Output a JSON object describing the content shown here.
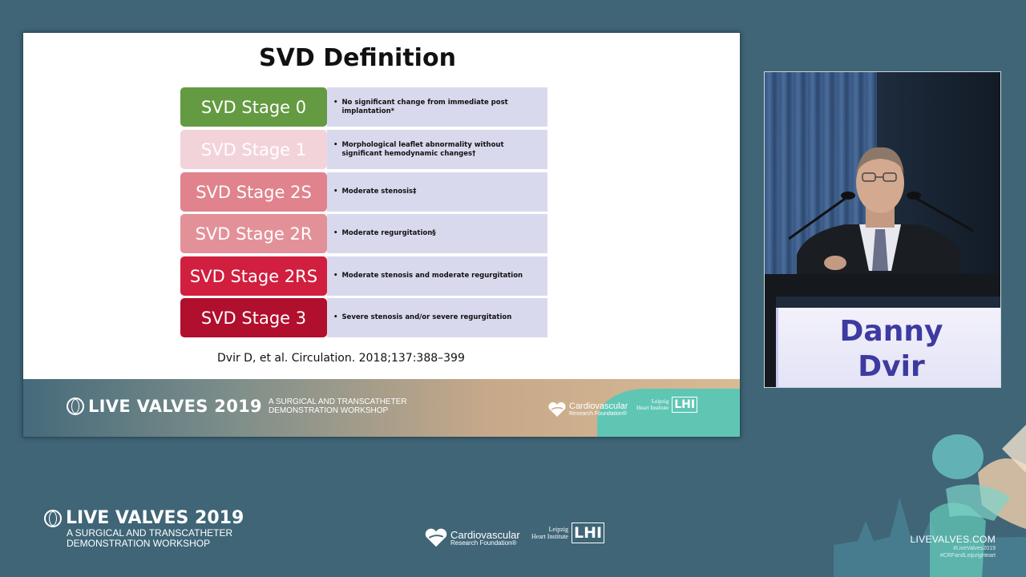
{
  "slide": {
    "title": "SVD Definition",
    "stages": [
      {
        "label": "SVD Stage 0",
        "description": "No significant change from immediate post implantation*",
        "color": "#649a41"
      },
      {
        "label": "SVD Stage 1",
        "description": "Morphological leaflet abnormality without significant hemodynamic changes†",
        "color": "#f3d3da"
      },
      {
        "label": "SVD Stage 2S",
        "description": "Moderate stenosis‡",
        "color": "#e0838d"
      },
      {
        "label": "SVD Stage 2R",
        "description": "Moderate regurgitation§",
        "color": "#e39199"
      },
      {
        "label": "SVD Stage 2RS",
        "description": "Moderate stenosis and moderate regurgitation",
        "color": "#d11f3f"
      },
      {
        "label": "SVD Stage 3",
        "description": "Severe stenosis and/or severe regurgitation",
        "color": "#b10f2e"
      }
    ],
    "bullet": "•",
    "citation": "Dvir D, et al. Circulation. 2018;137:388–399",
    "footer": {
      "event_name": "LIVE VALVES 2019",
      "event_sub_1": "A SURGICAL AND TRANSCATHETER",
      "event_sub_2": "DEMONSTRATION WORKSHOP",
      "crf_line1": "Cardiovascular",
      "crf_line2": "Research Foundation®",
      "lhi_line1": "Leipzig",
      "lhi_line2": "Heart Institute",
      "lhi_mark": "LHI"
    }
  },
  "speaker": {
    "first_name": "Danny",
    "last_name": "Dvir"
  },
  "bottom": {
    "event_name": "LIVE VALVES 2019",
    "event_sub_1": "A SURGICAL AND TRANSCATHETER",
    "event_sub_2": "DEMONSTRATION WORKSHOP",
    "crf_line1": "Cardiovascular",
    "crf_line2": "Research Foundation®",
    "lhi_line1": "Leipzig",
    "lhi_line2": "Heart Institute",
    "lhi_mark": "LHI",
    "website": "LIVEVALVES.COM",
    "hashtag1": "#LiveValves2019",
    "hashtag2": "#CRFandLeipzigHeart"
  },
  "colors": {
    "background": "#3f6577",
    "description_bg": "#d9d9ee",
    "speaker_name": "#3d3aa0",
    "teal_accent": "#5fc6b4"
  }
}
